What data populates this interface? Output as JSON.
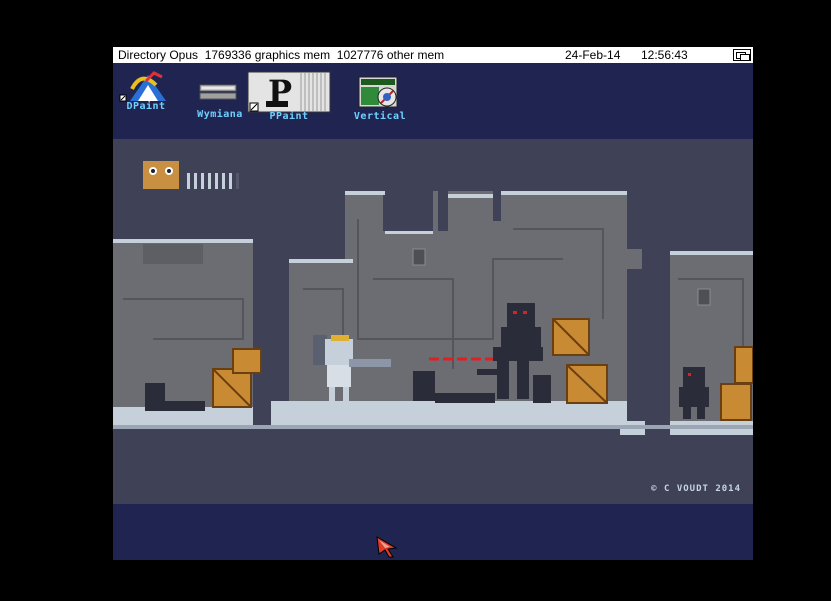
{
  "titlebar": {
    "app_and_memory": "Directory Opus  1769336 graphics mem  1027776 other mem",
    "date": "24-Feb-14",
    "time": "12:56:43"
  },
  "desktop_icons": [
    {
      "label": "DPaint",
      "icon": "dpaint-icon"
    },
    {
      "label": "Wymiana",
      "icon": "drive-icon"
    },
    {
      "label": "PPaint",
      "icon": "ppaint-icon"
    },
    {
      "label": "Vertical",
      "icon": "vertical-icon"
    }
  ],
  "game": {
    "health_pips": 7,
    "copyright": "© C VOUDT 2014"
  },
  "colors": {
    "workbench_bg": "#1f2550",
    "icon_label": "#6fd0ff",
    "game_bg": "#3f4256",
    "wall": "#6f7074",
    "laser": "#e02020"
  }
}
